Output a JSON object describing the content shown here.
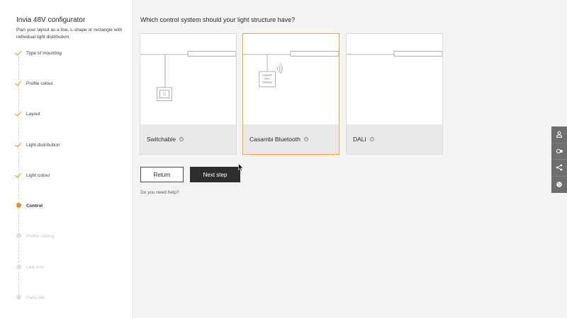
{
  "sidebar": {
    "title": "Invia 48V configurator",
    "subtitle": "Plan your layout as a line, L-shape or rectangle with individual light distribution.",
    "steps": [
      {
        "label": "Type of mounting",
        "state": "done"
      },
      {
        "label": "Profile colour",
        "state": "done"
      },
      {
        "label": "Layout",
        "state": "done"
      },
      {
        "label": "Light distribution",
        "state": "done"
      },
      {
        "label": "Light colour",
        "state": "done"
      },
      {
        "label": "Control",
        "state": "active"
      },
      {
        "label": "Profile setting",
        "state": "pending"
      },
      {
        "label": "Live end",
        "state": "pending"
      },
      {
        "label": "Parts list",
        "state": "pending"
      }
    ]
  },
  "main": {
    "question": "Which control system should your light structure have?",
    "options": [
      {
        "label": "Switchable",
        "info": "i",
        "selected": false
      },
      {
        "label": "Casambi Bluetooth",
        "info": "i",
        "selected": true,
        "gateway_text": [
          "Casambi",
          "DALI",
          "Gateway"
        ]
      },
      {
        "label": "DALI",
        "info": "i",
        "selected": false
      }
    ],
    "return_label": "Return",
    "next_label": "Next step",
    "help_label": "Do you need help?"
  },
  "toolbar": {
    "icons": [
      "person-icon",
      "toggle-icon",
      "share-icon",
      "cookie-icon"
    ]
  },
  "colors": {
    "accent": "#f08a1c",
    "selected_border": "#f5a552",
    "primary_button": "#2d2d2d",
    "toolbar_bg": "#6e6e6e"
  }
}
